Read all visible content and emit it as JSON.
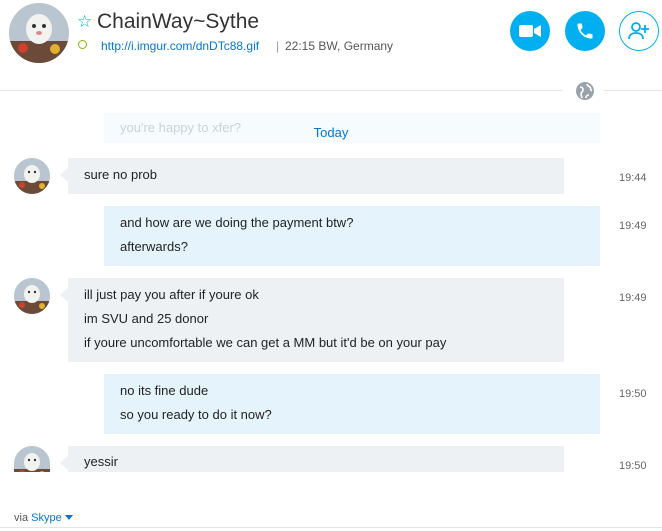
{
  "header": {
    "contact_name": "ChainWay~Sythe",
    "mood_link": "http://i.imgur.com/dnDTc88.gif",
    "separator": "|",
    "local_time": "22:15 BW, Germany",
    "buttons": {
      "video_icon": "video-camera-icon",
      "call_icon": "phone-icon",
      "add_people_icon": "add-person-icon"
    },
    "accent_color": "#00aff0",
    "presence_color": "#7fba00"
  },
  "conversation": {
    "faded_message": "you're happy to xfer?",
    "date_divider": "Today",
    "messages": [
      {
        "direction": "in",
        "lines": [
          "sure no prob"
        ],
        "time": "19:44"
      },
      {
        "direction": "out",
        "lines": [
          "and how are we doing the payment btw?",
          "afterwards?"
        ],
        "time": "19:49"
      },
      {
        "direction": "in",
        "lines": [
          "ill just pay you after if youre ok",
          "im SVU and 25 donor",
          "if youre uncomfortable we can get a MM but it'd be on your pay"
        ],
        "time": "19:49"
      },
      {
        "direction": "out",
        "lines": [
          "no its fine dude",
          "so you ready to do it now?"
        ],
        "time": "19:50"
      },
      {
        "direction": "in",
        "lines": [
          "yessir"
        ],
        "time": "19:50"
      }
    ]
  },
  "footer": {
    "via_label": "via",
    "service_label": "Skype"
  }
}
